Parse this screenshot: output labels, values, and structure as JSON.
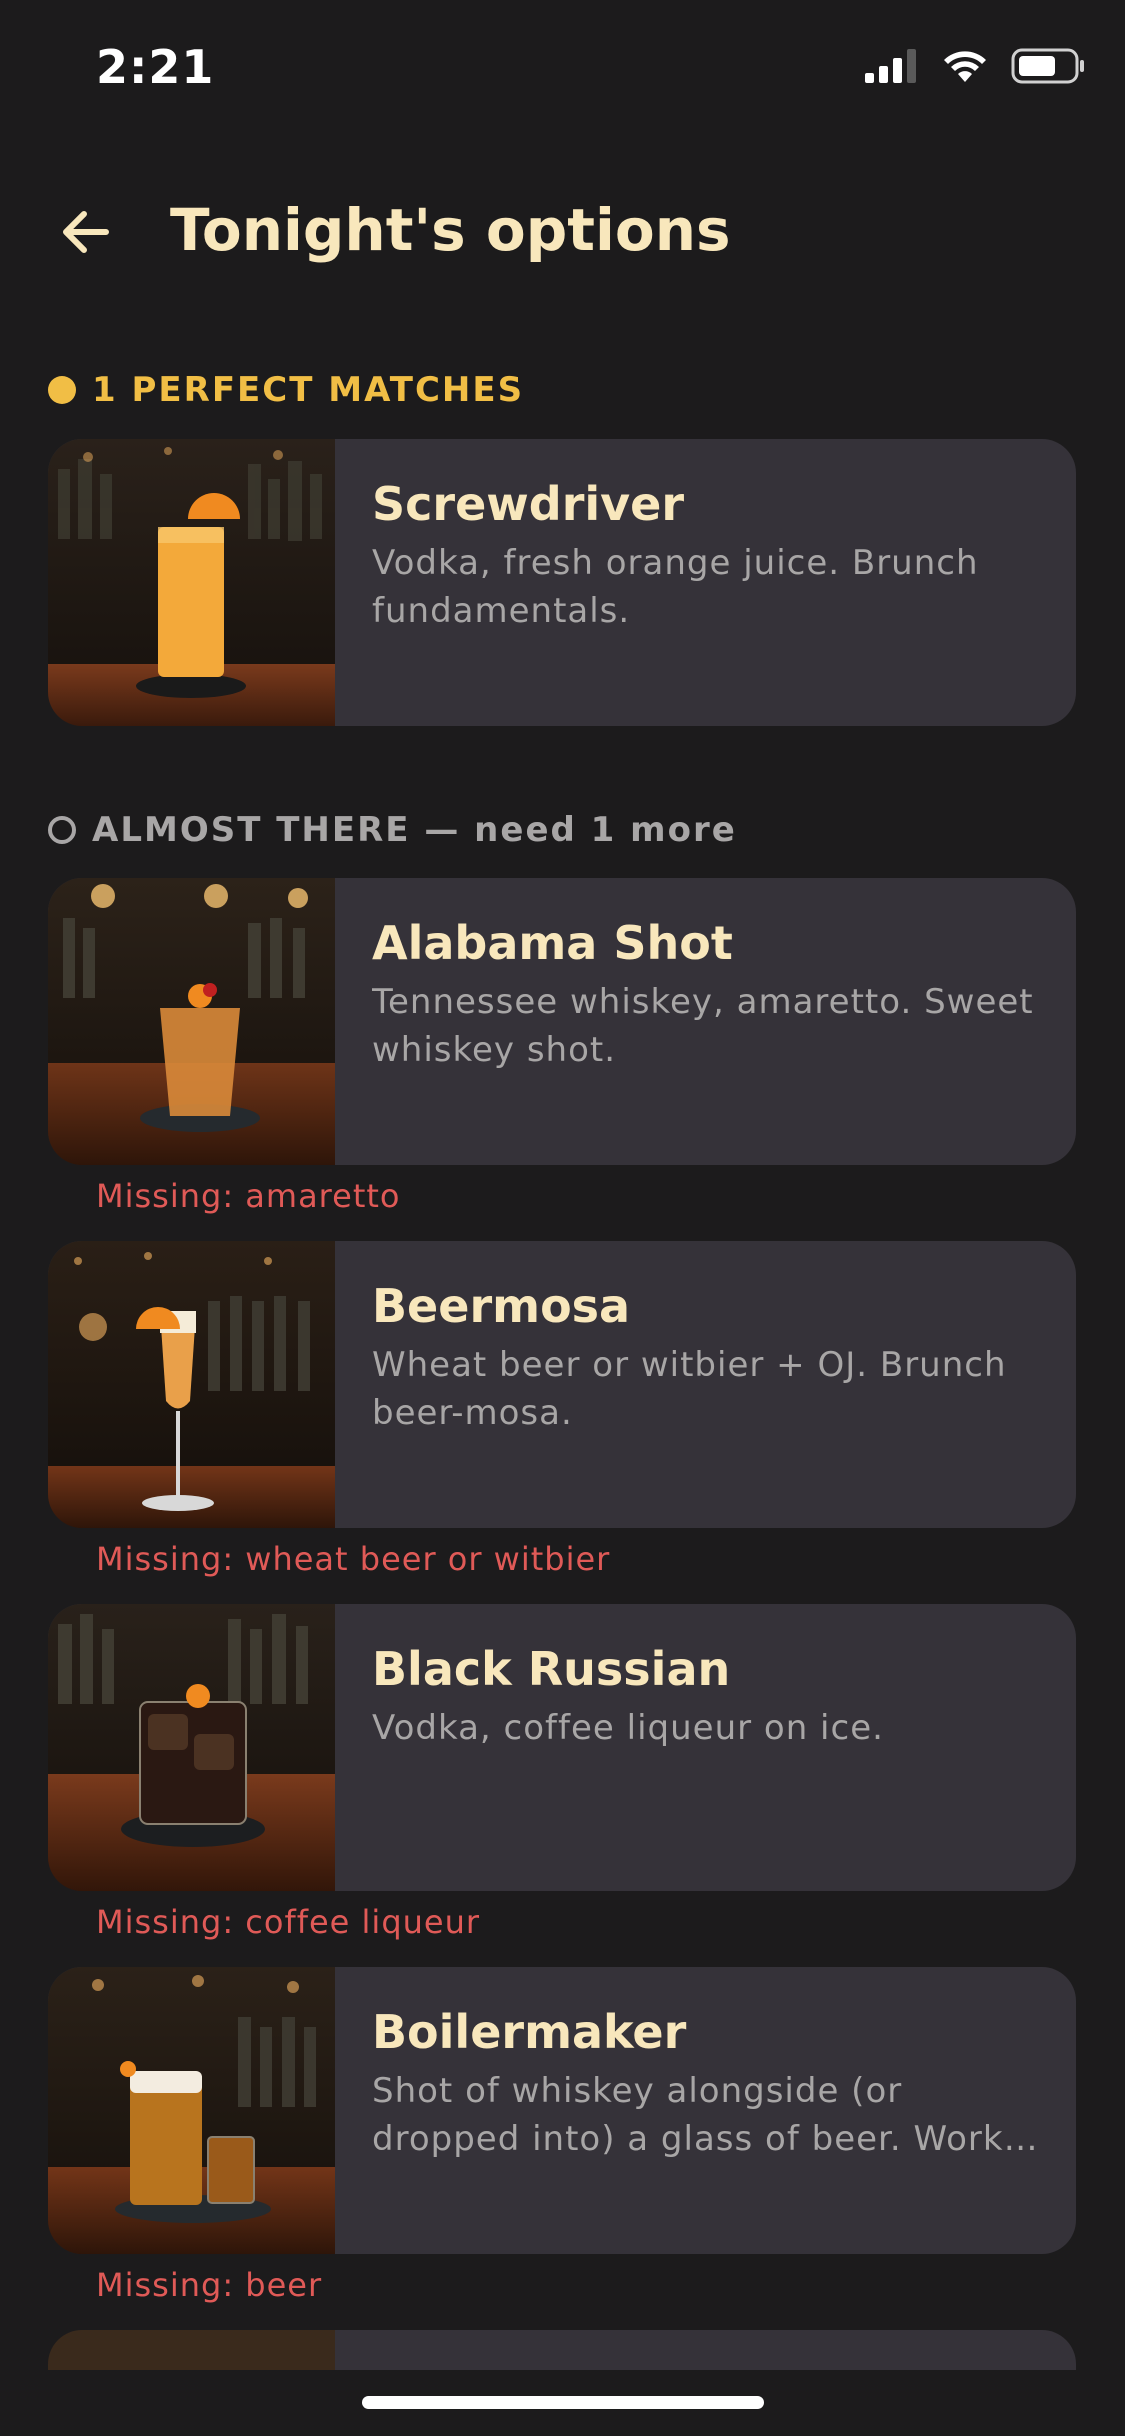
{
  "status": {
    "time": "2:21"
  },
  "header": {
    "title": "Tonight's options"
  },
  "perfect_section": {
    "label": "1 PERFECT MATCHES"
  },
  "almost_section": {
    "label": "ALMOST THERE — need 1 more"
  },
  "perfect_items": [
    {
      "name": "Screwdriver",
      "description": "Vodka, fresh orange juice. Brunch fundamentals."
    }
  ],
  "almost_items": [
    {
      "name": "Alabama Shot",
      "description": "Tennessee whiskey, amaretto. Sweet whiskey shot.",
      "missing": "Missing: amaretto"
    },
    {
      "name": "Beermosa",
      "description": "Wheat beer or witbier + OJ. Brunch beer-mosa.",
      "missing": "Missing: wheat beer or witbier"
    },
    {
      "name": "Black Russian",
      "description": "Vodka, coffee liqueur on ice.",
      "missing": "Missing: coffee liqueur"
    },
    {
      "name": "Boilermaker",
      "description": "Shot of whiskey alongside (or dropped into) a glass of beer. Work…",
      "missing": "Missing: beer"
    }
  ],
  "colors": {
    "accent": "#f1be45",
    "title": "#f8e7bc",
    "missing": "#e05a57",
    "card": "#353239",
    "background": "#1c1b1c"
  }
}
